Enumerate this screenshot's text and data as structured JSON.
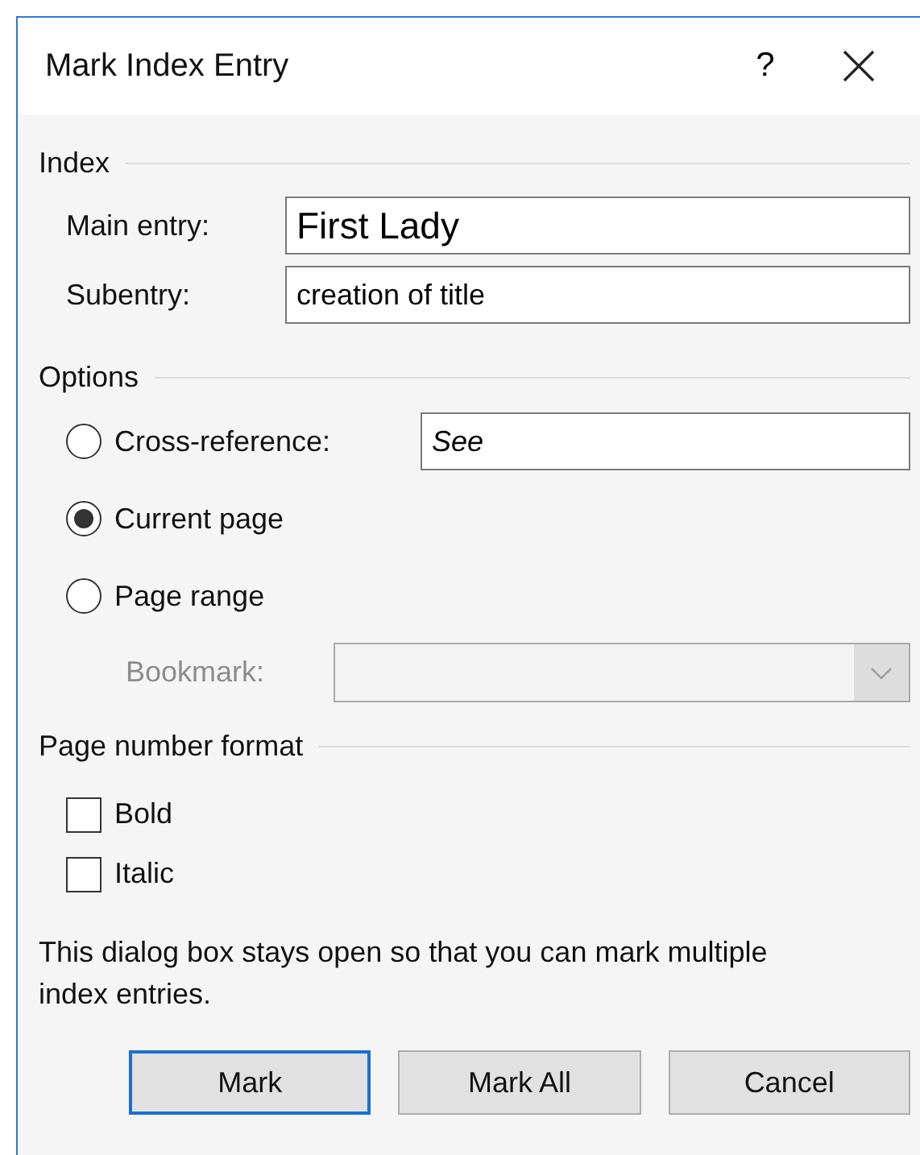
{
  "dialog": {
    "title": "Mark Index Entry",
    "help": "?"
  },
  "index_group": {
    "heading": "Index",
    "fields": [
      {
        "kind": "large",
        "label": "Main entry:",
        "value": "First Lady"
      },
      {
        "kind": "normal",
        "label": "Subentry:",
        "value": "creation of title"
      }
    ]
  },
  "options_group": {
    "heading": "Options",
    "items": [
      {
        "kind": "radio-field",
        "label": "Cross-reference:",
        "selected": false,
        "value": "See"
      },
      {
        "kind": "radio",
        "label": "Current page",
        "selected": true
      },
      {
        "kind": "radio",
        "label": "Page range",
        "selected": false
      },
      {
        "kind": "combo",
        "label": "Bookmark:",
        "disabled": true
      }
    ]
  },
  "format_group": {
    "heading": "Page number format",
    "checkboxes": [
      {
        "label": "Bold",
        "checked": false
      },
      {
        "label": "Italic",
        "checked": false
      }
    ]
  },
  "note": "This dialog box stays open so that you can mark multiple index entries.",
  "buttons": [
    {
      "label": "Mark",
      "default": true
    },
    {
      "label": "Mark All",
      "default": false
    },
    {
      "label": "Cancel",
      "default": false
    }
  ]
}
